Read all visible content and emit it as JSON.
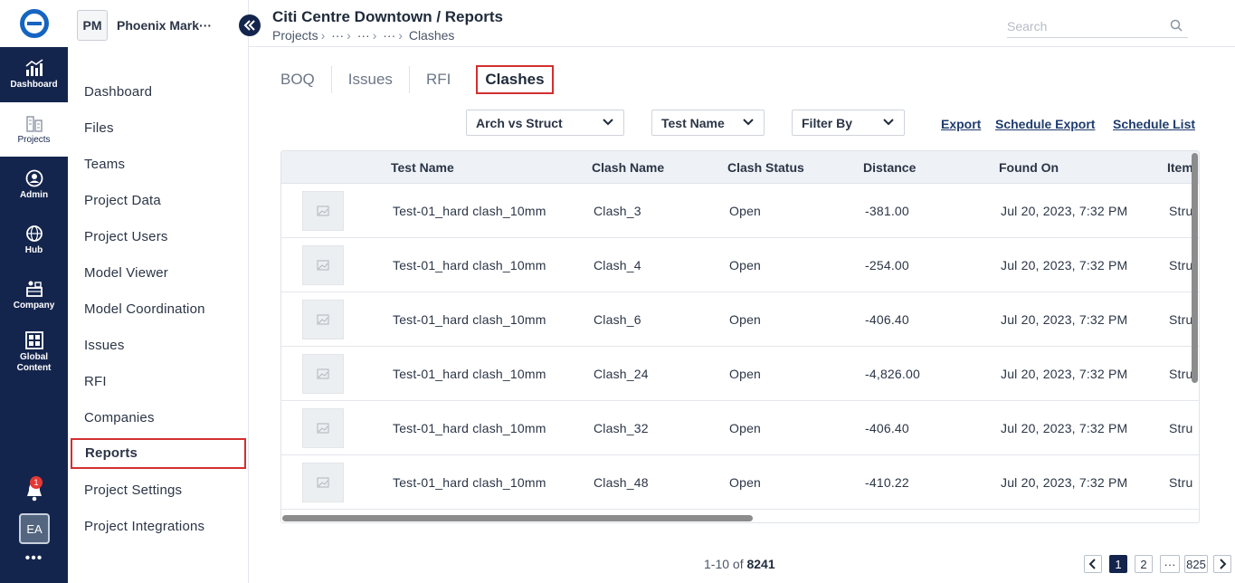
{
  "rail": {
    "items": [
      {
        "label": "Dashboard",
        "icon": "chart-icon"
      },
      {
        "label": "Projects",
        "icon": "buildings-icon"
      },
      {
        "label": "Admin",
        "icon": "admin-icon"
      },
      {
        "label": "Hub",
        "icon": "globe-icon"
      },
      {
        "label": "Company",
        "icon": "company-icon"
      },
      {
        "label": "Global Content",
        "icon": "grid-icon"
      }
    ],
    "notification_count": "1",
    "avatar": "EA",
    "more": "•••"
  },
  "project": {
    "badge": "PM",
    "name": "Phoenix Mark···"
  },
  "nav": {
    "items": [
      "Dashboard",
      "Files",
      "Teams",
      "Project Data",
      "Project Users",
      "Model Viewer",
      "Model Coordination",
      "Issues",
      "RFI",
      "Companies",
      "Reports",
      "Project Settings",
      "Project Integrations"
    ],
    "active": "Reports"
  },
  "header": {
    "title": "Citi Centre Downtown / Reports",
    "breadcrumb": [
      "Projects",
      "···",
      "···",
      "···",
      "Clashes"
    ],
    "search_placeholder": "Search"
  },
  "tabs": [
    "BOQ",
    "Issues",
    "RFI",
    "Clashes"
  ],
  "active_tab": "Clashes",
  "filters": {
    "dropdown1": "Arch vs Struct",
    "dropdown2": "Test Name",
    "dropdown3": "Filter By",
    "export": "Export",
    "schedule_export": "Schedule Export",
    "schedule_list": "Schedule List"
  },
  "table": {
    "columns": [
      "Test Name",
      "Clash Name",
      "Clash Status",
      "Distance",
      "Found On",
      "Item"
    ],
    "rows": [
      {
        "test": "Test-01_hard clash_10mm",
        "clash": "Clash_3",
        "status": "Open",
        "distance": "-381.00",
        "found": "Jul 20, 2023, 7:32 PM",
        "item": "Stru"
      },
      {
        "test": "Test-01_hard clash_10mm",
        "clash": "Clash_4",
        "status": "Open",
        "distance": "-254.00",
        "found": "Jul 20, 2023, 7:32 PM",
        "item": "Stru"
      },
      {
        "test": "Test-01_hard clash_10mm",
        "clash": "Clash_6",
        "status": "Open",
        "distance": "-406.40",
        "found": "Jul 20, 2023, 7:32 PM",
        "item": "Stru"
      },
      {
        "test": "Test-01_hard clash_10mm",
        "clash": "Clash_24",
        "status": "Open",
        "distance": "-4,826.00",
        "found": "Jul 20, 2023, 7:32 PM",
        "item": "Stru"
      },
      {
        "test": "Test-01_hard clash_10mm",
        "clash": "Clash_32",
        "status": "Open",
        "distance": "-406.40",
        "found": "Jul 20, 2023, 7:32 PM",
        "item": "Stru"
      },
      {
        "test": "Test-01_hard clash_10mm",
        "clash": "Clash_48",
        "status": "Open",
        "distance": "-410.22",
        "found": "Jul 20, 2023, 7:32 PM",
        "item": "Stru"
      }
    ]
  },
  "pagination": {
    "range": "1-10 of",
    "total": "8241",
    "pages": [
      "1",
      "2",
      "···",
      "825"
    ],
    "current": "1",
    "prev": "‹",
    "next": "›"
  },
  "colors": {
    "rail_bg": "#14254d",
    "active_outline": "#d32f2f",
    "logo_blue": "#1565c0"
  }
}
